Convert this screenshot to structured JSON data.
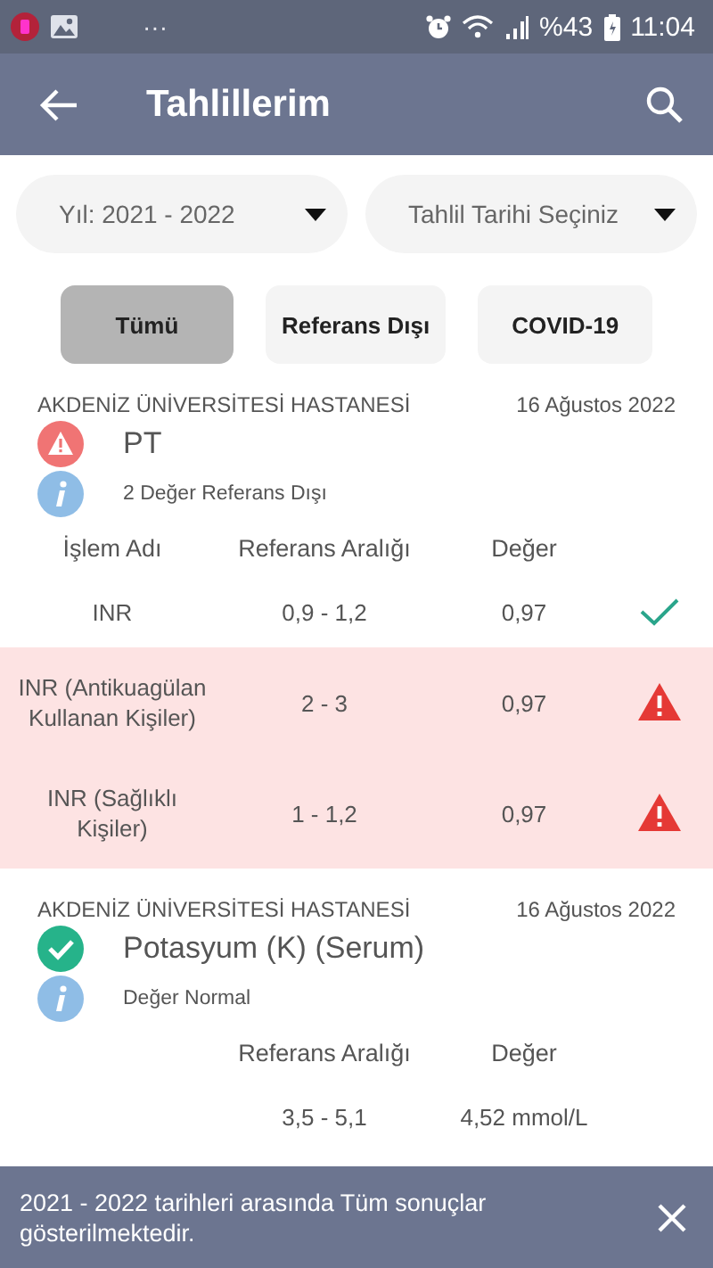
{
  "status_bar": {
    "dots": "···",
    "battery": "%43",
    "time": "11:04"
  },
  "toolbar": {
    "title": "Tahlillerim"
  },
  "dropdowns": [
    {
      "value": "Yıl: 2021 - 2022"
    },
    {
      "value": "Tahlil Tarihi Seçiniz"
    }
  ],
  "filters": [
    {
      "label": "Tümü",
      "selected": true
    },
    {
      "label": "Referans Dışı",
      "selected": false
    },
    {
      "label": "COVID-19",
      "selected": false
    }
  ],
  "cards": [
    {
      "hospital": "AKDENİZ ÜNİVERSİTESİ HASTANESİ",
      "date": "16 Ağustos 2022",
      "kind": "warning",
      "test": "PT",
      "info": "2 Değer Referans Dışı",
      "header": {
        "name": "İşlem Adı",
        "range": "Referans Aralığı",
        "value": "Değer"
      },
      "rows": [
        {
          "name": "INR",
          "range": "0,9 - 1,2",
          "value": "0,97",
          "kind": "normal"
        },
        {
          "name": "INR (Antikuagülan Kullanan Kişiler)",
          "range": "2 - 3",
          "value": "0,97",
          "kind": "out"
        },
        {
          "name": "INR (Sağlıklı Kişiler)",
          "range": "1 - 1,2",
          "value": "0,97",
          "kind": "out"
        }
      ]
    },
    {
      "hospital": "AKDENİZ ÜNİVERSİTESİ HASTANESİ",
      "date": "16 Ağustos 2022",
      "kind": "ok",
      "test": "Potasyum (K) (Serum)",
      "info": "Değer Normal",
      "header": {
        "range": "Referans Aralığı",
        "value": "Değer"
      },
      "rows": [
        {
          "range": "3,5 - 5,1",
          "value": "4,52 mmol/L"
        }
      ]
    }
  ],
  "snackbar": {
    "message": "2021 - 2022 tarihleri arasında Tüm sonuçlar gösterilmektedir."
  }
}
